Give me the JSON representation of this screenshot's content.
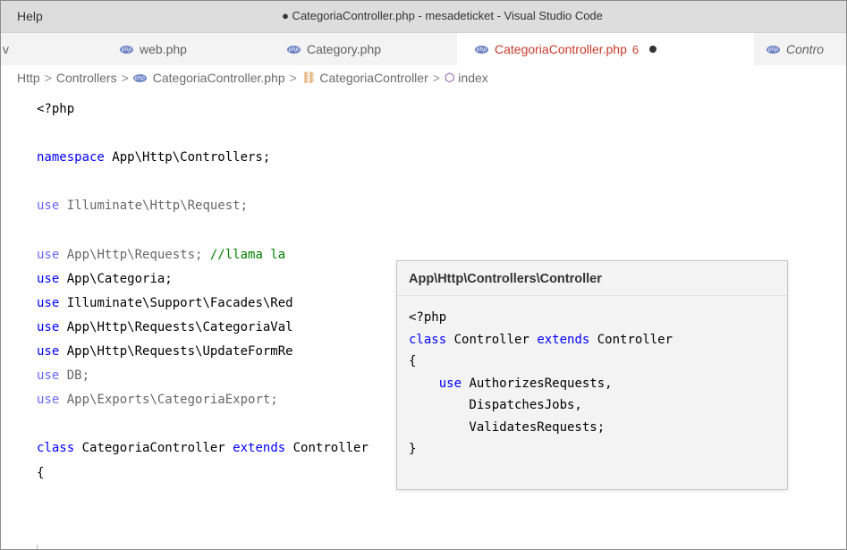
{
  "window": {
    "menu_help": "Help",
    "title": "● CategoriaController.php - mesadeticket - Visual Studio Code"
  },
  "tabs": [
    {
      "label": "v"
    },
    {
      "label": "web.php"
    },
    {
      "label": "Category.php"
    },
    {
      "label": "CategoriaController.php",
      "problems": "6",
      "active": true,
      "dirty": true
    },
    {
      "label": "Contro"
    }
  ],
  "breadcrumb": {
    "items": [
      "Http",
      "Controllers",
      "CategoriaController.php",
      "CategoriaController",
      "index"
    ],
    "separator": ">"
  },
  "code": {
    "lines": [
      {
        "segments": [
          {
            "t": "<?php",
            "c": "tx"
          }
        ]
      },
      {
        "segments": []
      },
      {
        "segments": [
          {
            "t": "namespace",
            "c": "kw"
          },
          {
            "t": " App\\Http\\Controllers;",
            "c": "tx"
          }
        ]
      },
      {
        "segments": []
      },
      {
        "segments": [
          {
            "t": "use",
            "c": "kw"
          },
          {
            "t": " Illuminate\\Http\\Request;",
            "c": "tx"
          }
        ],
        "dim": true
      },
      {
        "segments": []
      },
      {
        "segments": [
          {
            "t": "use",
            "c": "kw"
          },
          {
            "t": " App\\Http\\Requests; ",
            "c": "tx"
          },
          {
            "t": "//llama la",
            "c": "cm"
          }
        ],
        "dim_prefix": true
      },
      {
        "segments": [
          {
            "t": "use",
            "c": "kw"
          },
          {
            "t": " App\\Categoria;",
            "c": "tx"
          }
        ]
      },
      {
        "segments": [
          {
            "t": "use",
            "c": "kw"
          },
          {
            "t": " Illuminate\\Support\\Facades\\Red",
            "c": "tx"
          }
        ]
      },
      {
        "segments": [
          {
            "t": "use",
            "c": "kw"
          },
          {
            "t": " App\\Http\\Requests\\CategoriaVal",
            "c": "tx"
          }
        ]
      },
      {
        "segments": [
          {
            "t": "use",
            "c": "kw"
          },
          {
            "t": " App\\Http\\Requests\\UpdateFormRe",
            "c": "tx"
          }
        ]
      },
      {
        "segments": [
          {
            "t": "use",
            "c": "kw"
          },
          {
            "t": " DB;",
            "c": "tx"
          }
        ],
        "dim": true
      },
      {
        "segments": [
          {
            "t": "use",
            "c": "kw"
          },
          {
            "t": " App\\Exports\\CategoriaExport;",
            "c": "tx"
          }
        ],
        "dim": true
      },
      {
        "segments": []
      },
      {
        "segments": [
          {
            "t": "class",
            "c": "kw"
          },
          {
            "t": " CategoriaController ",
            "c": "tx"
          },
          {
            "t": "extends",
            "c": "kw"
          },
          {
            "t": " Controller",
            "c": "tx"
          }
        ]
      },
      {
        "segments": [
          {
            "t": "{",
            "c": "tx"
          }
        ]
      }
    ]
  },
  "hover": {
    "title": "App\\Http\\Controllers\\Controller",
    "lines": [
      {
        "segments": [
          {
            "t": "<?php",
            "c": "tx"
          }
        ]
      },
      {
        "segments": [
          {
            "t": "class",
            "c": "kw"
          },
          {
            "t": " Controller ",
            "c": "tx"
          },
          {
            "t": "extends",
            "c": "kw"
          },
          {
            "t": " Controller",
            "c": "tx"
          }
        ]
      },
      {
        "segments": [
          {
            "t": "{",
            "c": "tx"
          }
        ]
      },
      {
        "segments": [
          {
            "t": "    use",
            "c": "kw"
          },
          {
            "t": " AuthorizesRequests,",
            "c": "tx"
          }
        ]
      },
      {
        "segments": [
          {
            "t": "        DispatchesJobs,",
            "c": "tx"
          }
        ]
      },
      {
        "segments": [
          {
            "t": "        ValidatesRequests;",
            "c": "tx"
          }
        ]
      },
      {
        "segments": [
          {
            "t": "}",
            "c": "tx"
          }
        ]
      }
    ]
  },
  "colors": {
    "keyword": "#0000ff",
    "comment": "#008000",
    "active_tab_text": "#c83b2b",
    "php_icon": "#6d83c4"
  }
}
